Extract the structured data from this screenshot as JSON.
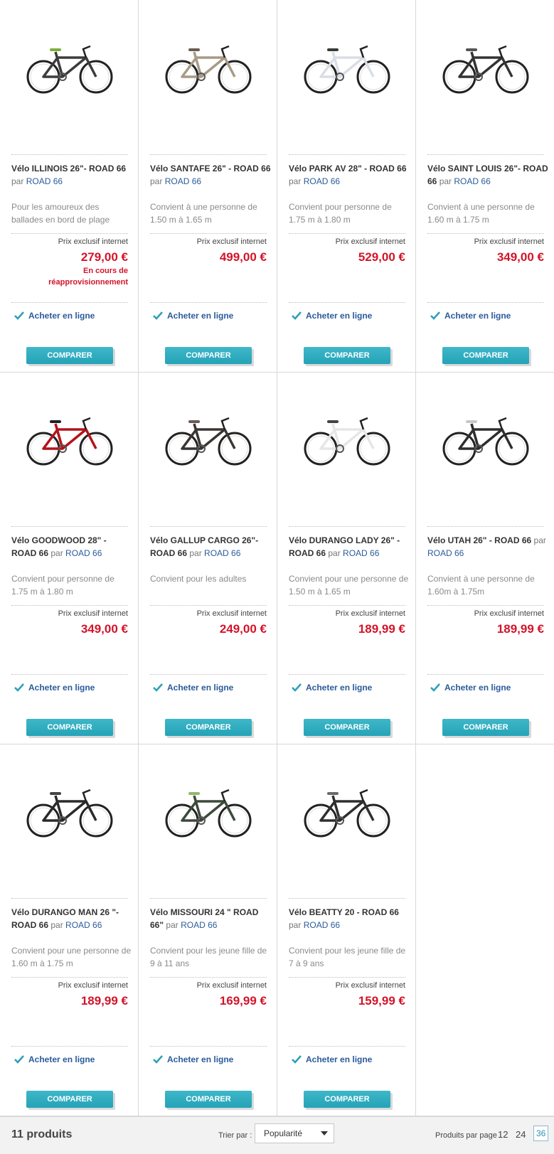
{
  "products": [
    {
      "name": "Vélo ILLINOIS 26\"- ROAD 66",
      "by": "par",
      "brand": "ROAD 66",
      "desc": "Pour les amoureux des ballades en bord de plage",
      "price_label": "Prix exclusif internet",
      "price": "279,00 €",
      "stock": "En cours de réapprovisionnement",
      "buy": "Acheter en ligne",
      "compare": "COMPARER",
      "frame_color": "#3c3c3c",
      "accent": "#7bb03a"
    },
    {
      "name": "Vélo SANTAFE 26\" - ROAD 66",
      "by": "par",
      "brand": "ROAD 66",
      "desc": "Convient à une personne de 1.50 m à 1.65 m",
      "price_label": "Prix exclusif internet",
      "price": "499,00 €",
      "stock": "",
      "buy": "Acheter en ligne",
      "compare": "COMPARER",
      "frame_color": "#a89a86",
      "accent": "#6b5d4c"
    },
    {
      "name": "Vélo PARK AV 28\" - ROAD 66",
      "by": "par",
      "brand": "ROAD 66",
      "desc": "Convient pour personne de 1.75 m à 1.80 m",
      "price_label": "Prix exclusif internet",
      "price": "529,00 €",
      "stock": "",
      "buy": "Acheter en ligne",
      "compare": "COMPARER",
      "frame_color": "#d9dee6",
      "accent": "#3a3a3a"
    },
    {
      "name": "Vélo SAINT LOUIS 26\"- ROAD 66",
      "by": "par",
      "brand": "ROAD 66",
      "desc": "Convient à une personne de 1.60 m à 1.75 m",
      "price_label": "Prix exclusif internet",
      "price": "349,00 €",
      "stock": "",
      "buy": "Acheter en ligne",
      "compare": "COMPARER",
      "frame_color": "#333333",
      "accent": "#555555"
    },
    {
      "name": "Vélo GOODWOOD 28\" - ROAD 66",
      "by": "par",
      "brand": "ROAD 66",
      "desc": "Convient pour personne de 1.75 m à 1.80 m",
      "price_label": "Prix exclusif internet",
      "price": "349,00 €",
      "stock": "",
      "buy": "Acheter en ligne",
      "compare": "COMPARER",
      "frame_color": "#b3121b",
      "accent": "#222222"
    },
    {
      "name": "Vélo GALLUP CARGO 26\"- ROAD 66",
      "by": "par",
      "brand": "ROAD 66",
      "desc": "Convient pour les adultes",
      "price_label": "Prix exclusif internet",
      "price": "249,00 €",
      "stock": "",
      "buy": "Acheter en ligne",
      "compare": "COMPARER",
      "frame_color": "#3a3533",
      "accent": "#6b5a55"
    },
    {
      "name": "Vélo DURANGO LADY 26\" - ROAD 66",
      "by": "par",
      "brand": "ROAD 66",
      "desc": "Convient pour une personne de 1.50 m à 1.65 m",
      "price_label": "Prix exclusif internet",
      "price": "189,99 €",
      "stock": "",
      "buy": "Acheter en ligne",
      "compare": "COMPARER",
      "frame_color": "#e6e6e6",
      "accent": "#444444"
    },
    {
      "name": "Vélo UTAH 26\" - ROAD 66",
      "by": "par",
      "brand": "ROAD 66",
      "desc": "Convient à une personne de 1.60m à 1.75m",
      "price_label": "Prix exclusif internet",
      "price": "189,99 €",
      "stock": "",
      "buy": "Acheter en ligne",
      "compare": "COMPARER",
      "frame_color": "#2e2e2e",
      "accent": "#c8c8c8"
    },
    {
      "name": "Vélo DURANGO MAN 26 \"- ROAD 66",
      "by": "par",
      "brand": "ROAD 66",
      "desc": "Convient pour une personne de 1.60 m à 1.75 m",
      "price_label": "Prix exclusif internet",
      "price": "189,99 €",
      "stock": "",
      "buy": "Acheter en ligne",
      "compare": "COMPARER",
      "frame_color": "#2a2a2a",
      "accent": "#444444"
    },
    {
      "name": "Vélo MISSOURI 24 \" ROAD 66\"",
      "by": "par",
      "brand": "ROAD 66",
      "desc": "Convient pour les jeune fille de 9 à 11 ans",
      "price_label": "Prix exclusif internet",
      "price": "169,99 €",
      "stock": "",
      "buy": "Acheter en ligne",
      "compare": "COMPARER",
      "frame_color": "#3b4a3a",
      "accent": "#8fb86a"
    },
    {
      "name": "Vélo BEATTY 20 - ROAD 66",
      "by": "par",
      "brand": "ROAD 66",
      "desc": "Convient pour les jeune fille de 7 à 9 ans",
      "price_label": "Prix exclusif internet",
      "price": "159,99 €",
      "stock": "",
      "buy": "Acheter en ligne",
      "compare": "COMPARER",
      "frame_color": "#2f2f2f",
      "accent": "#6a6a6a"
    }
  ],
  "footer": {
    "count": "11 produits",
    "sort_label": "Trier par :",
    "sort_value": "Popularité",
    "per_page_label": "Produits par page",
    "per_page_options": [
      "12",
      "24",
      "36"
    ],
    "per_page_active": "36"
  },
  "colors": {
    "price": "#d2142a",
    "brand_link": "#2a5b9a",
    "compare_button": "#2aa9bd"
  }
}
